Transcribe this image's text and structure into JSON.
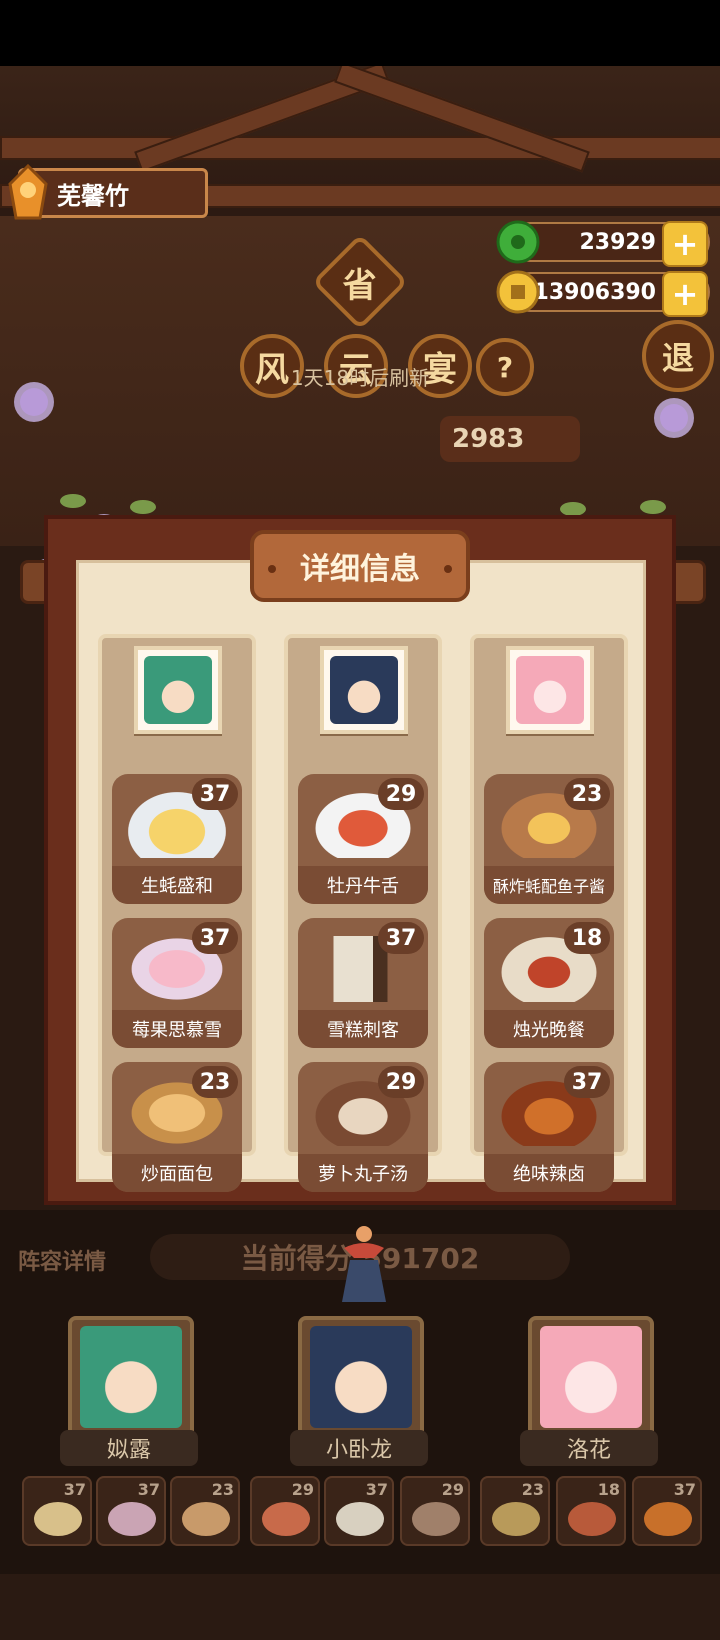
{
  "player": {
    "name": "芜馨竹"
  },
  "currency": {
    "jade": "23929",
    "coins": "13906390"
  },
  "event": {
    "province_label": "省",
    "title_chars": [
      "风",
      "云",
      "宴"
    ],
    "help": "?",
    "exit": "退",
    "refresh": "1天18时后刷新",
    "score_partial": "2983"
  },
  "panel": {
    "title": "详细信息",
    "columns": [
      {
        "dishes": [
          {
            "name": "生蚝盛和",
            "level": "37"
          },
          {
            "name": "莓果思慕雪",
            "level": "37"
          },
          {
            "name": "炒面面包",
            "level": "23"
          }
        ]
      },
      {
        "dishes": [
          {
            "name": "牡丹牛舌",
            "level": "29"
          },
          {
            "name": "雪糕刺客",
            "level": "37"
          },
          {
            "name": "萝卜丸子汤",
            "level": "29"
          }
        ]
      },
      {
        "dishes": [
          {
            "name": "酥炸蚝配鱼子酱",
            "level": "23"
          },
          {
            "name": "烛光晚餐",
            "level": "18"
          },
          {
            "name": "绝味辣卤",
            "level": "37"
          }
        ]
      }
    ]
  },
  "bottom": {
    "team_label": "阵容详情",
    "current_score": "当前得分 591702",
    "chefs": [
      "姒露",
      "小卧龙",
      "洛花"
    ],
    "mini_levels": [
      "37",
      "37",
      "23",
      "29",
      "37",
      "29",
      "23",
      "18",
      "37"
    ]
  },
  "colors": {
    "accent": "#b2683a",
    "panel_bg": "#f1e3c8",
    "dish_bg": "#8c5f44"
  }
}
